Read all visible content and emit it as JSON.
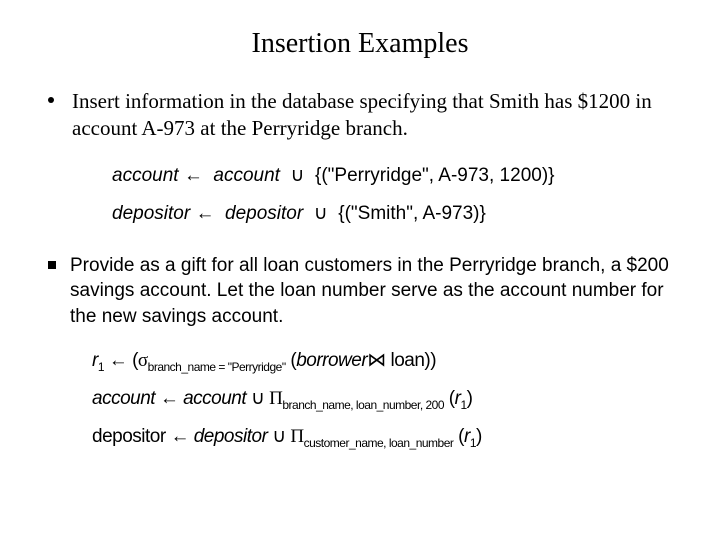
{
  "title": "Insertion Examples",
  "item1": {
    "text": "Insert information in the database specifying that Smith has $1200 in account A-973 at the Perryridge branch.",
    "formula1_lhs": "account",
    "formula1_rhs": "account",
    "formula1_set": "{(\"Perryridge\", A-973, 1200)}",
    "formula2_lhs": "depositor",
    "formula2_rhs": "depositor",
    "formula2_set": "{(\"Smith\", A-973)}"
  },
  "item2": {
    "text": "Provide as a gift for all loan customers in the Perryridge branch, a $200 savings account.  Let the loan number serve as the account number for the new savings account.",
    "line1": {
      "r": "r",
      "rsub": "1",
      "sigma_sub": "branch_name = \"Perryridge\"",
      "borrower": "borrower",
      "loan": "loan"
    },
    "line2": {
      "lhs": "account",
      "rhs": "account",
      "pi_sub": "branch_name, loan_number, 200",
      "r": "r",
      "rsub": "1"
    },
    "line3": {
      "lhs": "depositor",
      "rhs": "depositor",
      "pi_sub": "customer_name, loan_number",
      "r": "r",
      "rsub": "1"
    }
  },
  "sym": {
    "assign": "←",
    "union": "∪",
    "sigma": "σ",
    "pi": "Π",
    "join": "⋈"
  }
}
